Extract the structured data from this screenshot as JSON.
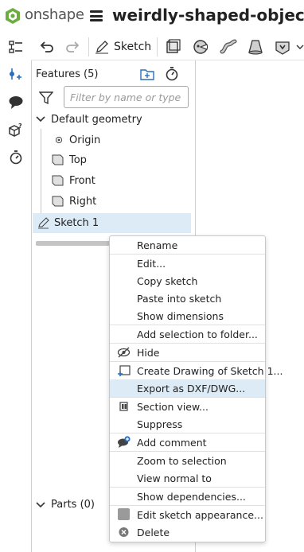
{
  "app": {
    "brand": "onshape",
    "document_title": "weirdly-shaped-object"
  },
  "toolbar": {
    "sketch_label": "Sketch"
  },
  "feature_panel": {
    "header": "Features (5)",
    "filter_placeholder": "Filter by name or type",
    "tree": {
      "group_label": "Default geometry",
      "origin": "Origin",
      "planes": [
        "Top",
        "Front",
        "Right"
      ],
      "sketch": "Sketch 1"
    },
    "parts_label": "Parts (0)"
  },
  "context_menu": {
    "items": [
      {
        "label": "Rename"
      },
      {
        "label": "Edit..."
      },
      {
        "label": "Copy sketch"
      },
      {
        "label": "Paste into sketch"
      },
      {
        "label": "Show dimensions"
      },
      {
        "label": "Add selection to folder..."
      },
      {
        "label": "Hide"
      },
      {
        "label": "Create Drawing of Sketch 1..."
      },
      {
        "label": "Export as DXF/DWG..."
      },
      {
        "label": "Section view..."
      },
      {
        "label": "Suppress"
      },
      {
        "label": "Add comment"
      },
      {
        "label": "Zoom to selection"
      },
      {
        "label": "View normal to"
      },
      {
        "label": "Show dependencies..."
      },
      {
        "label": "Edit sketch appearance..."
      },
      {
        "label": "Delete"
      }
    ],
    "highlighted": "Export as DXF/DWG..."
  },
  "colors": {
    "accent_green": "#5aa02c",
    "selection": "#dcebf6",
    "icon_blue": "#2a6fbf"
  }
}
